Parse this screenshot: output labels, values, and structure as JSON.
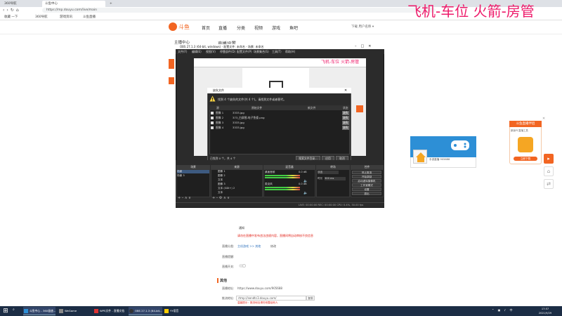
{
  "browser": {
    "tabs": [
      {
        "label": "360导航",
        "active": false
      },
      {
        "label": "斗鱼中心",
        "active": true
      },
      {
        "label": "+",
        "active": false
      }
    ],
    "url": "https://mp.douyu.com/live/main",
    "bookmarks": [
      "收藏 一下",
      "360导航",
      "游戏资讯",
      "斗鱼直播"
    ]
  },
  "site": {
    "logo_text": "斗鱼",
    "nav": [
      "首页",
      "直播",
      "分类",
      "视频",
      "游戏",
      "鱼吧"
    ],
    "user_area": "下载   用户名称 ▾",
    "sidebar_title": "主播中心",
    "settings_title": "直播设置"
  },
  "overlay": {
    "stream_title": "飞机-车位  火箭-房管",
    "preview_title": "飞机-车位  火箭-房管"
  },
  "obs": {
    "title": "OBS 27.1.3 (64-bit, windows) - 配置文件: 未命名 - 场景: 未命名",
    "menu": [
      "文件(F)",
      "编辑(E)",
      "视图(V)",
      "停靠部件(D)",
      "配置文件(P)",
      "场景集合(S)",
      "工具(T)",
      "帮助(H)"
    ],
    "dialog": {
      "title": "缺失文件",
      "message": "找到 4 个缺失的文件(共 4 个)。请找到文件或者替代。",
      "columns": [
        "源",
        "原始文件",
        "新文件",
        "状态"
      ],
      "rows": [
        {
          "source": "图像 1",
          "file": "3333.jpg",
          "status": "缺失"
        },
        {
          "source": "图像 2",
          "file": "373_白屏图-电子鱼瓷.png",
          "status": "缺失"
        },
        {
          "source": "图像 3",
          "file": "3333.jpg",
          "status": "缺失"
        },
        {
          "source": "图像 4",
          "file": "3333.jpg",
          "status": "缺失"
        }
      ],
      "found_text": "已找到 0 个，共 4 个",
      "buttons": [
        "搜索文件目录...",
        "应用",
        "取消"
      ]
    },
    "docks": {
      "headers": [
        "场景",
        "来源",
        "混音器",
        "转场",
        "控件"
      ],
      "scenes": [
        "场景",
        "场景 3"
      ],
      "sources": [
        "图像 1",
        "图像 2",
        "文本",
        "图像 3",
        "文本 (GDI+) 2",
        "文本"
      ],
      "mixer": [
        {
          "label": "桌面音频",
          "value": "0.0 dB"
        },
        {
          "label": "麦克风",
          "value": "0.0 dB"
        }
      ],
      "transition": {
        "type": "淡出",
        "duration_label": "时长",
        "duration": "300 ms"
      },
      "controls": [
        "停止推流",
        "开始录制",
        "启动虚拟摄像机",
        "工作室模式",
        "设置",
        "退出"
      ]
    },
    "status": "LIVE: 00:00:00   REC: 00:00:00   CPU: 0.4%, 30.00 fps"
  },
  "page": {
    "notice_label": "通知",
    "notice_red": "请勿在直播中发布违法违规内容，直播间将自动审核不良信息",
    "category_label": "直播分类:",
    "category_value": "主机游戏 >> 其他",
    "category_edit": "修改",
    "gift_label": "直播提醒:",
    "toggle_label": "直播开关:",
    "section_title": "其他",
    "address_label": "直播地址:",
    "address_value": "https://www.douyu.com/905688",
    "rtmp_label": "推流地址:",
    "rtmp_value": "rtmp://sendtc3.douyu.com/",
    "copy_label": "复制",
    "rtmp_warn": "温馨提示：推流地址请勿泄露给他人"
  },
  "widgets": {
    "game_text": "手游直播",
    "game_sub": "905688",
    "promo_title": "斗鱼直播伴侣",
    "promo_sub": "新版PC直播工具",
    "promo_btn": "立即下载"
  },
  "taskbar": {
    "items": [
      "斗鱼中心 - 360极速...",
      "WeGame",
      "WPS文件 - 直播文档",
      "OBS 27.1.3 (64-bit...",
      "YY语音"
    ],
    "clock_time": "17:57",
    "clock_date": "2021/9/29"
  },
  "colors": {
    "accent": "#f26522",
    "overlay": "#ee1a6a",
    "taskbar": "#1c2d45"
  }
}
